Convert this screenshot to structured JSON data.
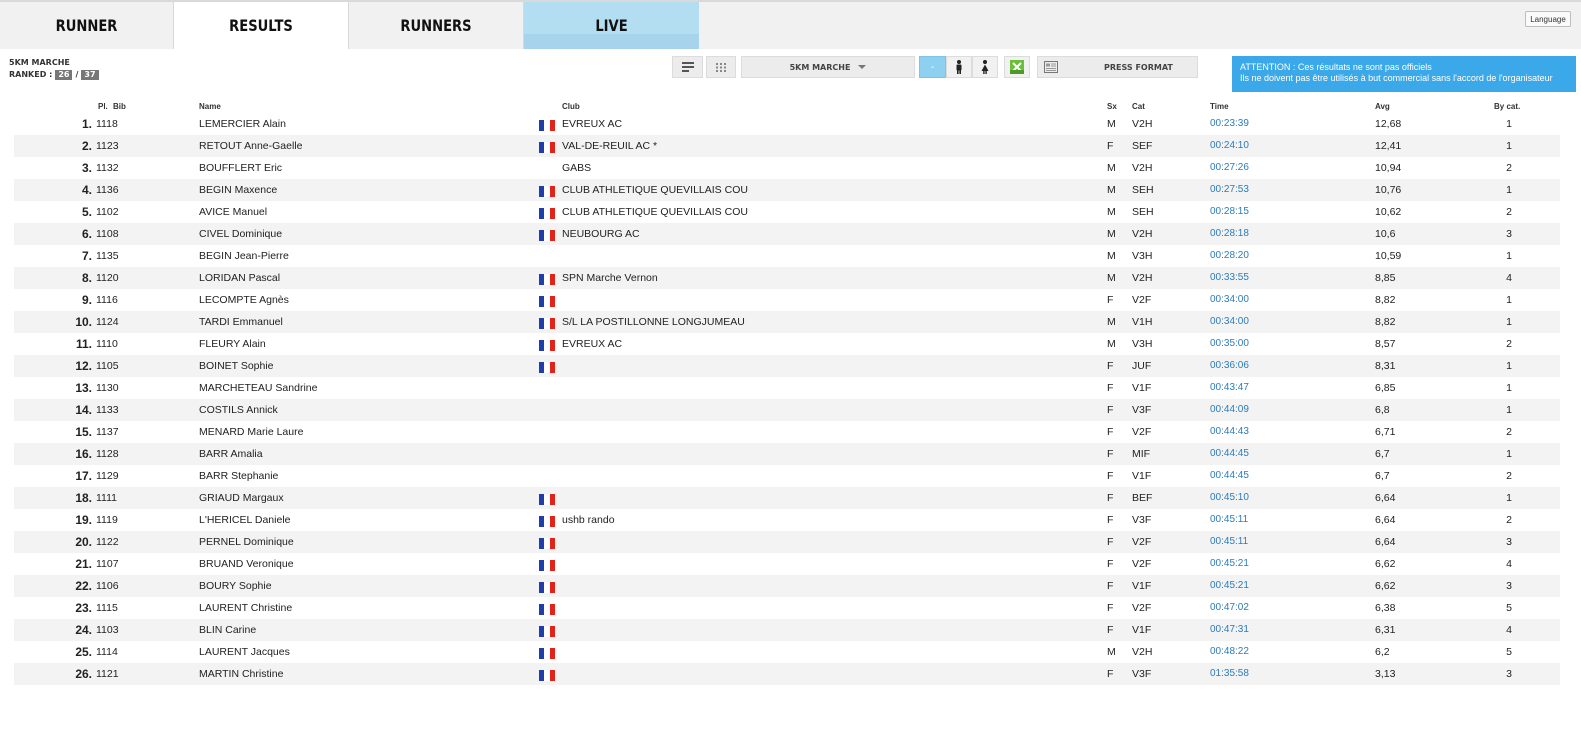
{
  "nav": {
    "tabs": [
      "RUNNER",
      "RESULTS",
      "RUNNERS",
      "LIVE"
    ],
    "language": "Language"
  },
  "race": {
    "name": "5KM MARCHE",
    "ranked_label": "RANKED :",
    "ranked": "26",
    "total": "37"
  },
  "toolbar": {
    "race_select": "5KM MARCHE",
    "all_label": "-",
    "press_format": "PRESS FORMAT"
  },
  "notice": {
    "line1": "ATTENTION : Ces résultats ne sont pas officiels",
    "line2": "Ils ne doivent pas être utilisés à but commercial sans l'accord de l'organisateur"
  },
  "colors": {
    "accent": "#3ba9e9",
    "time_link": "#2b7bbd",
    "live_tab": "#b3def1",
    "flag_blue": "#1f3ea8",
    "flag_white": "#ffffff",
    "flag_red": "#e2231a"
  },
  "table": {
    "headers": {
      "pl": "Pl.",
      "bib": "Bib",
      "name": "Name",
      "club": "Club",
      "sx": "Sx",
      "cat": "Cat",
      "time": "Time",
      "avg": "Avg",
      "bycat": "By cat."
    },
    "rows": [
      {
        "pl": "1.",
        "bib": "1118",
        "name": "LEMERCIER Alain",
        "flag": true,
        "club": "EVREUX AC",
        "sx": "M",
        "cat": "V2H",
        "time": "00:23:39",
        "avg": "12,68",
        "bycat": "1"
      },
      {
        "pl": "2.",
        "bib": "1123",
        "name": "RETOUT Anne-Gaelle",
        "flag": true,
        "club": "VAL-DE-REUIL AC *",
        "sx": "F",
        "cat": "SEF",
        "time": "00:24:10",
        "avg": "12,41",
        "bycat": "1"
      },
      {
        "pl": "3.",
        "bib": "1132",
        "name": "BOUFFLERT Eric",
        "flag": false,
        "club": "GABS",
        "sx": "M",
        "cat": "V2H",
        "time": "00:27:26",
        "avg": "10,94",
        "bycat": "2"
      },
      {
        "pl": "4.",
        "bib": "1136",
        "name": "BEGIN Maxence",
        "flag": true,
        "club": "CLUB ATHLETIQUE QUEVILLAIS COU",
        "sx": "M",
        "cat": "SEH",
        "time": "00:27:53",
        "avg": "10,76",
        "bycat": "1"
      },
      {
        "pl": "5.",
        "bib": "1102",
        "name": "AVICE Manuel",
        "flag": true,
        "club": "CLUB ATHLETIQUE QUEVILLAIS COU",
        "sx": "M",
        "cat": "SEH",
        "time": "00:28:15",
        "avg": "10,62",
        "bycat": "2"
      },
      {
        "pl": "6.",
        "bib": "1108",
        "name": "CIVEL Dominique",
        "flag": true,
        "club": "NEUBOURG AC",
        "sx": "M",
        "cat": "V2H",
        "time": "00:28:18",
        "avg": "10,6",
        "bycat": "3"
      },
      {
        "pl": "7.",
        "bib": "1135",
        "name": "BEGIN Jean-Pierre",
        "flag": false,
        "club": "",
        "sx": "M",
        "cat": "V3H",
        "time": "00:28:20",
        "avg": "10,59",
        "bycat": "1"
      },
      {
        "pl": "8.",
        "bib": "1120",
        "name": "LORIDAN Pascal",
        "flag": true,
        "club": "SPN Marche Vernon",
        "sx": "M",
        "cat": "V2H",
        "time": "00:33:55",
        "avg": "8,85",
        "bycat": "4"
      },
      {
        "pl": "9.",
        "bib": "1116",
        "name": "LECOMPTE Agnès",
        "flag": true,
        "club": "",
        "sx": "F",
        "cat": "V2F",
        "time": "00:34:00",
        "avg": "8,82",
        "bycat": "1"
      },
      {
        "pl": "10.",
        "bib": "1124",
        "name": "TARDI Emmanuel",
        "flag": true,
        "club": "S/L LA POSTILLONNE LONGJUMEAU",
        "sx": "M",
        "cat": "V1H",
        "time": "00:34:00",
        "avg": "8,82",
        "bycat": "1"
      },
      {
        "pl": "11.",
        "bib": "1110",
        "name": "FLEURY Alain",
        "flag": true,
        "club": "EVREUX AC",
        "sx": "M",
        "cat": "V3H",
        "time": "00:35:00",
        "avg": "8,57",
        "bycat": "2"
      },
      {
        "pl": "12.",
        "bib": "1105",
        "name": "BOINET Sophie",
        "flag": true,
        "club": "",
        "sx": "F",
        "cat": "JUF",
        "time": "00:36:06",
        "avg": "8,31",
        "bycat": "1"
      },
      {
        "pl": "13.",
        "bib": "1130",
        "name": "MARCHETEAU Sandrine",
        "flag": false,
        "club": "",
        "sx": "F",
        "cat": "V1F",
        "time": "00:43:47",
        "avg": "6,85",
        "bycat": "1"
      },
      {
        "pl": "14.",
        "bib": "1133",
        "name": "COSTILS Annick",
        "flag": false,
        "club": "",
        "sx": "F",
        "cat": "V3F",
        "time": "00:44:09",
        "avg": "6,8",
        "bycat": "1"
      },
      {
        "pl": "15.",
        "bib": "1137",
        "name": "MENARD Marie Laure",
        "flag": false,
        "club": "",
        "sx": "F",
        "cat": "V2F",
        "time": "00:44:43",
        "avg": "6,71",
        "bycat": "2"
      },
      {
        "pl": "16.",
        "bib": "1128",
        "name": "BARR Amalia",
        "flag": false,
        "club": "",
        "sx": "F",
        "cat": "MIF",
        "time": "00:44:45",
        "avg": "6,7",
        "bycat": "1"
      },
      {
        "pl": "17.",
        "bib": "1129",
        "name": "BARR Stephanie",
        "flag": false,
        "club": "",
        "sx": "F",
        "cat": "V1F",
        "time": "00:44:45",
        "avg": "6,7",
        "bycat": "2"
      },
      {
        "pl": "18.",
        "bib": "1111",
        "name": "GRIAUD Margaux",
        "flag": true,
        "club": "",
        "sx": "F",
        "cat": "BEF",
        "time": "00:45:10",
        "avg": "6,64",
        "bycat": "1"
      },
      {
        "pl": "19.",
        "bib": "1119",
        "name": "L'HERICEL Daniele",
        "flag": true,
        "club": "ushb rando",
        "sx": "F",
        "cat": "V3F",
        "time": "00:45:11",
        "avg": "6,64",
        "bycat": "2"
      },
      {
        "pl": "20.",
        "bib": "1122",
        "name": "PERNEL Dominique",
        "flag": true,
        "club": "",
        "sx": "F",
        "cat": "V2F",
        "time": "00:45:11",
        "avg": "6,64",
        "bycat": "3"
      },
      {
        "pl": "21.",
        "bib": "1107",
        "name": "BRUAND Veronique",
        "flag": true,
        "club": "",
        "sx": "F",
        "cat": "V2F",
        "time": "00:45:21",
        "avg": "6,62",
        "bycat": "4"
      },
      {
        "pl": "22.",
        "bib": "1106",
        "name": "BOURY Sophie",
        "flag": true,
        "club": "",
        "sx": "F",
        "cat": "V1F",
        "time": "00:45:21",
        "avg": "6,62",
        "bycat": "3"
      },
      {
        "pl": "23.",
        "bib": "1115",
        "name": "LAURENT Christine",
        "flag": true,
        "club": "",
        "sx": "F",
        "cat": "V2F",
        "time": "00:47:02",
        "avg": "6,38",
        "bycat": "5"
      },
      {
        "pl": "24.",
        "bib": "1103",
        "name": "BLIN Carine",
        "flag": true,
        "club": "",
        "sx": "F",
        "cat": "V1F",
        "time": "00:47:31",
        "avg": "6,31",
        "bycat": "4"
      },
      {
        "pl": "25.",
        "bib": "1114",
        "name": "LAURENT Jacques",
        "flag": true,
        "club": "",
        "sx": "M",
        "cat": "V2H",
        "time": "00:48:22",
        "avg": "6,2",
        "bycat": "5"
      },
      {
        "pl": "26.",
        "bib": "1121",
        "name": "MARTIN Christine",
        "flag": true,
        "club": "",
        "sx": "F",
        "cat": "V3F",
        "time": "01:35:58",
        "avg": "3,13",
        "bycat": "3"
      }
    ]
  }
}
